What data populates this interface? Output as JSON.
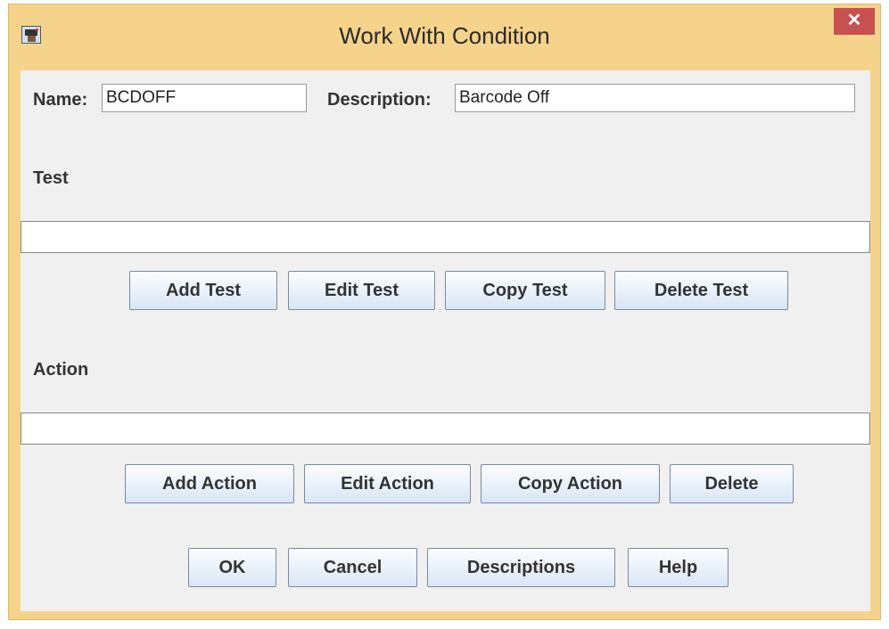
{
  "window": {
    "title": "Work With Condition",
    "close_glyph": "✕",
    "icon": "app-icon"
  },
  "form": {
    "name_label": "Name:",
    "name_value": "BCDOFF",
    "description_label": "Description:",
    "description_value": "Barcode Off"
  },
  "test": {
    "heading": "Test",
    "value": "",
    "buttons": [
      "Add Test",
      "Edit Test",
      "Copy Test",
      "Delete Test"
    ]
  },
  "action": {
    "heading": "Action",
    "value": "",
    "buttons": [
      "Add Action",
      "Edit Action",
      "Copy Action",
      "Delete"
    ]
  },
  "footer": {
    "buttons": [
      "OK",
      "Cancel",
      "Descriptions",
      "Help"
    ]
  }
}
